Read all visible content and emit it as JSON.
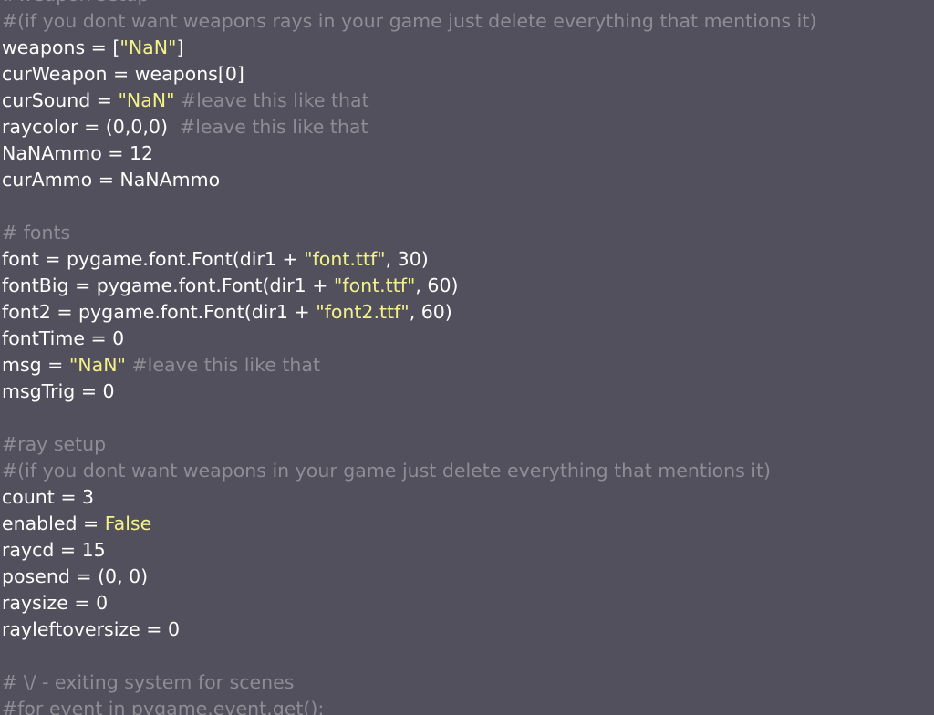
{
  "colors": {
    "background": "#51505c",
    "text": "#ffffff",
    "string": "#f4f18a",
    "comment": "#8e8d96"
  },
  "lines": [
    [
      {
        "t": "comment",
        "v": "#weapon setup"
      }
    ],
    [
      {
        "t": "comment",
        "v": "#(if you dont want weapons rays in your game just delete everything that mentions it)"
      }
    ],
    [
      {
        "t": "plain",
        "v": "weapons = ["
      },
      {
        "t": "string",
        "v": "\"NaN\""
      },
      {
        "t": "plain",
        "v": "]"
      }
    ],
    [
      {
        "t": "plain",
        "v": "curWeapon = weapons[0]"
      }
    ],
    [
      {
        "t": "plain",
        "v": "curSound = "
      },
      {
        "t": "string",
        "v": "\"NaN\""
      },
      {
        "t": "comment",
        "v": " #leave this like that"
      }
    ],
    [
      {
        "t": "plain",
        "v": "raycolor = (0,0,0)  "
      },
      {
        "t": "comment",
        "v": "#leave this like that"
      }
    ],
    [
      {
        "t": "plain",
        "v": "NaNAmmo = 12"
      }
    ],
    [
      {
        "t": "plain",
        "v": "curAmmo = NaNAmmo"
      }
    ],
    [],
    [
      {
        "t": "comment",
        "v": "# fonts"
      }
    ],
    [
      {
        "t": "plain",
        "v": "font = pygame.font.Font(dir1 + "
      },
      {
        "t": "string",
        "v": "\"font.ttf\""
      },
      {
        "t": "plain",
        "v": ", 30)"
      }
    ],
    [
      {
        "t": "plain",
        "v": "fontBig = pygame.font.Font(dir1 + "
      },
      {
        "t": "string",
        "v": "\"font.ttf\""
      },
      {
        "t": "plain",
        "v": ", 60)"
      }
    ],
    [
      {
        "t": "plain",
        "v": "font2 = pygame.font.Font(dir1 + "
      },
      {
        "t": "string",
        "v": "\"font2.ttf\""
      },
      {
        "t": "plain",
        "v": ", 60)"
      }
    ],
    [
      {
        "t": "plain",
        "v": "fontTime = 0"
      }
    ],
    [
      {
        "t": "plain",
        "v": "msg = "
      },
      {
        "t": "string",
        "v": "\"NaN\""
      },
      {
        "t": "comment",
        "v": " #leave this like that"
      }
    ],
    [
      {
        "t": "plain",
        "v": "msgTrig = 0"
      }
    ],
    [],
    [
      {
        "t": "comment",
        "v": "#ray setup"
      }
    ],
    [
      {
        "t": "comment",
        "v": "#(if you dont want weapons in your game just delete everything that mentions it)"
      }
    ],
    [
      {
        "t": "plain",
        "v": "count = 3"
      }
    ],
    [
      {
        "t": "plain",
        "v": "enabled = "
      },
      {
        "t": "keyword",
        "v": "False"
      }
    ],
    [
      {
        "t": "plain",
        "v": "raycd = 15"
      }
    ],
    [
      {
        "t": "plain",
        "v": "posend = (0, 0)"
      }
    ],
    [
      {
        "t": "plain",
        "v": "raysize = 0"
      }
    ],
    [
      {
        "t": "plain",
        "v": "rayleftoversize = 0"
      }
    ],
    [],
    [
      {
        "t": "comment",
        "v": "# \\/ - exiting system for scenes"
      }
    ],
    [
      {
        "t": "comment",
        "v": "#for event in pygame.event.get():"
      }
    ]
  ]
}
